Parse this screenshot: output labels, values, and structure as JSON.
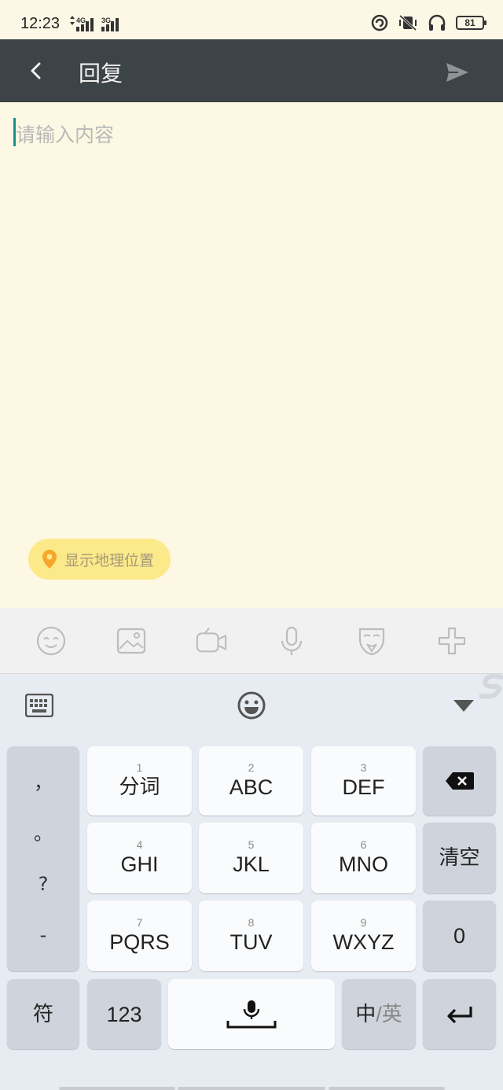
{
  "status_bar": {
    "time": "12:23",
    "network_1": "4G",
    "network_2": "3G",
    "battery": "81"
  },
  "app_bar": {
    "title": "回复"
  },
  "editor": {
    "placeholder": "请输入内容",
    "location_chip": "显示地理位置"
  },
  "toolbar": {
    "items": [
      "emoji-icon",
      "image-icon",
      "video-icon",
      "microphone-icon",
      "mask-icon",
      "plus-icon"
    ]
  },
  "keyboard": {
    "punctuation": [
      "，",
      "。",
      "?",
      "-"
    ],
    "keys": [
      {
        "num": "1",
        "label": "分词"
      },
      {
        "num": "2",
        "label": "ABC"
      },
      {
        "num": "3",
        "label": "DEF"
      },
      {
        "num": "4",
        "label": "GHI"
      },
      {
        "num": "5",
        "label": "JKL"
      },
      {
        "num": "6",
        "label": "MNO"
      },
      {
        "num": "7",
        "label": "PQRS"
      },
      {
        "num": "8",
        "label": "TUV"
      },
      {
        "num": "9",
        "label": "WXYZ"
      }
    ],
    "clear_label": "清空",
    "zero_label": "0",
    "symbol_label": "符",
    "numeric_label": "123",
    "lang_primary": "中",
    "lang_sep": "/",
    "lang_secondary": "英"
  },
  "colors": {
    "app_bar": "#3d4448",
    "editor_bg": "#fdf8e3",
    "chip_bg": "#fce98a",
    "caret": "#1a8f8f"
  }
}
